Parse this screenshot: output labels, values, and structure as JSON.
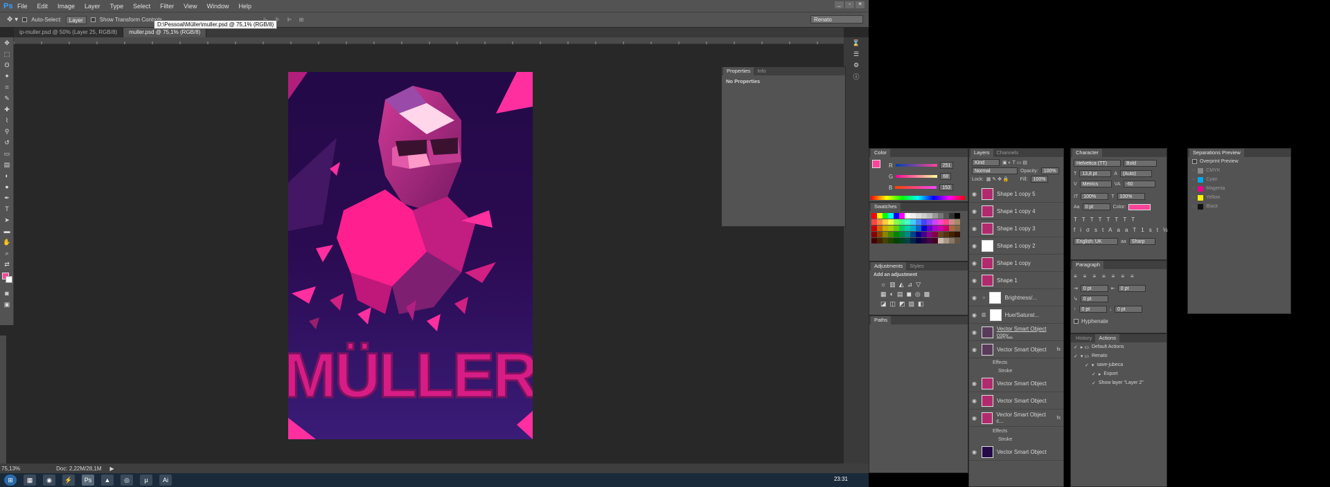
{
  "app": {
    "logo": "Ps",
    "menu": [
      "File",
      "Edit",
      "Image",
      "Layer",
      "Type",
      "Select",
      "Filter",
      "View",
      "Window",
      "Help"
    ]
  },
  "options": {
    "auto_select_label": "Auto-Select:",
    "auto_select_value": "Layer",
    "transform_label": "Show Transform Controls",
    "workspace": "Renato"
  },
  "tooltip": "D:\\Pessoal\\Müller\\muller.psd @ 75,1% (RGB/8)",
  "tabs": [
    {
      "label": "ip-muller.psd @ 50% (Layer 25, RGB/8)"
    },
    {
      "label": "muller.psd @ 75,1% (RGB/8)"
    }
  ],
  "ruler": [
    "20",
    "0",
    "20",
    "0",
    "0",
    "0",
    "0",
    "0",
    "0",
    "0",
    "0",
    "0"
  ],
  "artwork_text": "MÜLLER",
  "status": {
    "zoom": "75,13%",
    "doc": "Doc: 2,22M/28,1M"
  },
  "properties": {
    "tabs": [
      "Properties",
      "Info"
    ],
    "text": "No Properties"
  },
  "color": {
    "title": "Color",
    "r_label": "R",
    "g_label": "G",
    "b_label": "B",
    "r": "251",
    "g": "68",
    "b": "153"
  },
  "swatches": {
    "title": "Swatches"
  },
  "adjustments": {
    "tabs": [
      "Adjustments",
      "Styles"
    ],
    "heading": "Add an adjustment"
  },
  "paths": {
    "title": "Paths"
  },
  "layers": {
    "tabs": [
      "Layers",
      "Channels"
    ],
    "kind": "Kind",
    "blend": "Normal",
    "opacity_label": "Opacity:",
    "opacity": "100%",
    "lock_label": "Lock:",
    "fill_label": "Fill:",
    "fill": "100%",
    "items": [
      {
        "name": "Shape 1 copy 5"
      },
      {
        "name": "Shape 1 copy 4"
      },
      {
        "name": "Shape 1 copy 3"
      },
      {
        "name": "Shape 1 copy 2"
      },
      {
        "name": "Shape 1 copy"
      },
      {
        "name": "Shape 1"
      },
      {
        "name": "Brightness/..."
      },
      {
        "name": "Hue/Saturat..."
      },
      {
        "name": "Vector Smart Object copy..."
      },
      {
        "name": "Vector Smart Object"
      },
      {
        "name": "Vector Smart Object"
      },
      {
        "name": "Vector Smart Object"
      },
      {
        "name": "Vector Smart Object c..."
      },
      {
        "name": "Vector Smart Object"
      }
    ],
    "effects": "Effects",
    "stroke": "Stroke",
    "fx": "fx"
  },
  "character": {
    "title": "Character",
    "font": "Helvetica (TT)",
    "style": "Bold",
    "size": "13,8 pt",
    "leading": "(Auto)",
    "kerning": "Metrics",
    "tracking": "-60",
    "vscale": "100%",
    "hscale": "100%",
    "baseline": "0 pt",
    "color_label": "Color:",
    "language": "English: UK",
    "aa": "Sharp"
  },
  "paragraph": {
    "title": "Paragraph",
    "indent1": "0 pt",
    "indent2": "0 pt",
    "indent3": "0 pt",
    "space1": "0 pt",
    "space2": "0 pt",
    "hyphenate": "Hyphenate"
  },
  "history": {
    "tabs": [
      "History",
      "Actions"
    ],
    "items": [
      "Default Actions",
      "Renato",
      "save-jubeca",
      "Export",
      "Show layer \"Layer 2\""
    ]
  },
  "separations": {
    "title": "Separations Preview",
    "overprint": "Overprint Preview",
    "items": [
      "CMYK",
      "Cyan",
      "Magenta",
      "Yellow",
      "Black"
    ]
  },
  "taskbar": {
    "clock": "23:31"
  },
  "colors": {
    "fg": "#fb4499",
    "bg": "#ffffff",
    "cyan": "#00a8e8",
    "magenta": "#ec008c",
    "yellow": "#fff200",
    "black": "#111111"
  }
}
